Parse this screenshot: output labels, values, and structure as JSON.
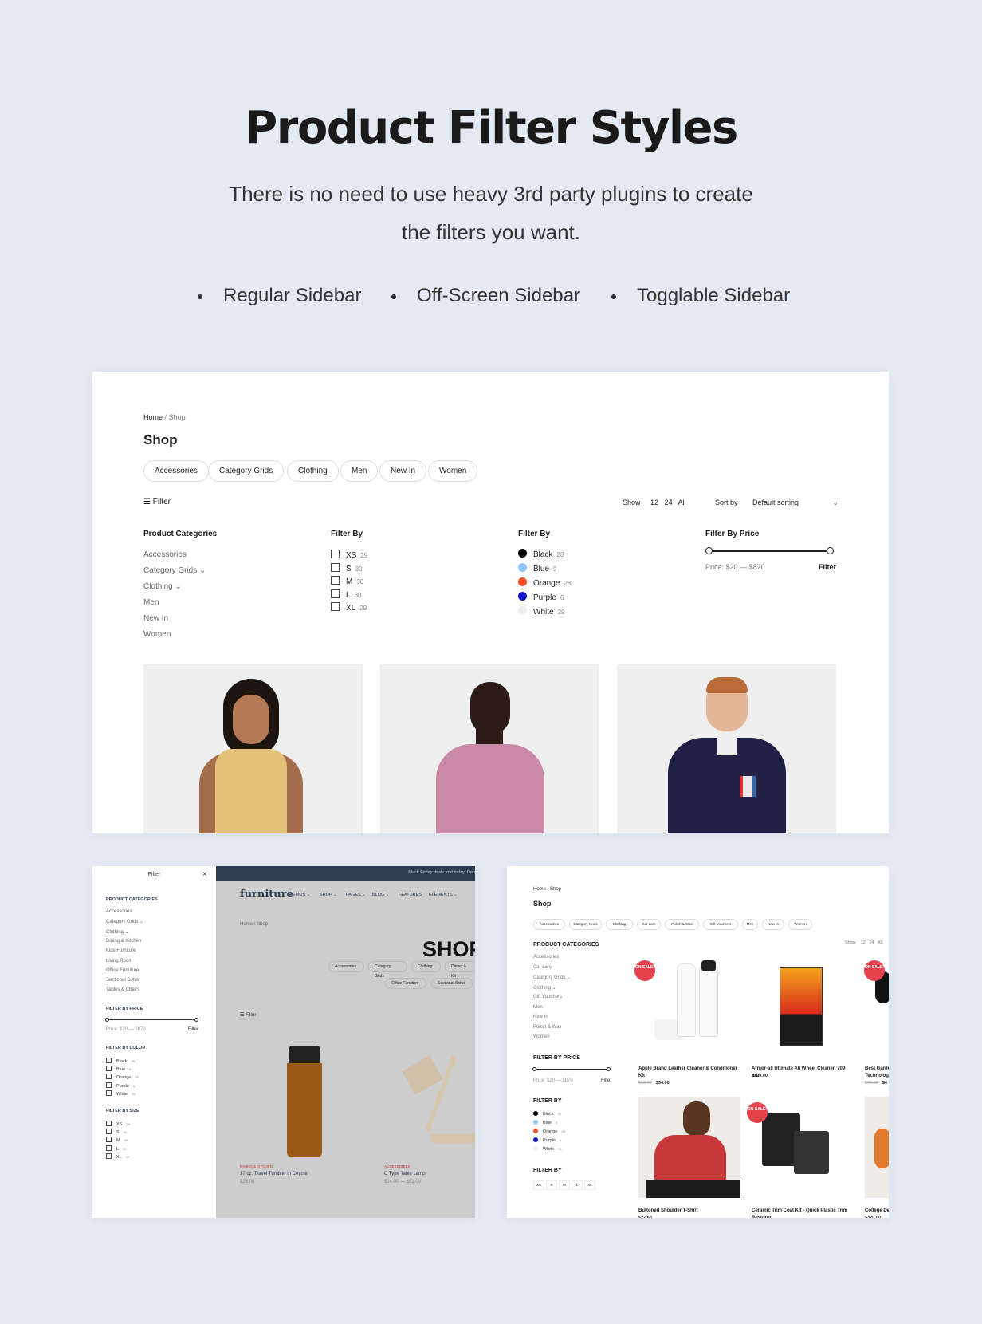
{
  "hero": {
    "title": "Product Filter Styles",
    "subtitle_line1": "There is no need to use heavy 3rd party plugins to create",
    "subtitle_line2": "the filters you want.",
    "bullets": [
      "Regular Sidebar",
      "Off-Screen Sidebar",
      "Togglable Sidebar"
    ]
  },
  "regular": {
    "breadcrumb": {
      "home": "Home",
      "sep": "/",
      "current": "Shop"
    },
    "title": "Shop",
    "pills": [
      "Accessories",
      "Category Grids",
      "Clothing",
      "Men",
      "New In",
      "Women"
    ],
    "filter_label": "Filter",
    "show_label": "Show",
    "show_options": [
      "12",
      "24",
      "All"
    ],
    "sort_label": "Sort by",
    "sort_value": "Default sorting",
    "categories": {
      "heading": "Product Categories",
      "items": [
        "Accessories",
        "Category Grids ⌄",
        "Clothing ⌄",
        "Men",
        "New In",
        "Women"
      ]
    },
    "sizes": {
      "heading": "Filter By",
      "items": [
        {
          "label": "XS",
          "count": "29"
        },
        {
          "label": "S",
          "count": "30"
        },
        {
          "label": "M",
          "count": "30"
        },
        {
          "label": "L",
          "count": "30"
        },
        {
          "label": "XL",
          "count": "29"
        }
      ]
    },
    "colors": {
      "heading": "Filter By",
      "items": [
        {
          "label": "Black",
          "count": "28",
          "color": "#000000"
        },
        {
          "label": "Blue",
          "count": "9",
          "color": "#8ec5fc"
        },
        {
          "label": "Orange",
          "count": "28",
          "color": "#f4502b"
        },
        {
          "label": "Purple",
          "count": "6",
          "color": "#1414c8"
        },
        {
          "label": "White",
          "count": "29",
          "color": "#eeeeee"
        }
      ]
    },
    "price": {
      "heading": "Filter By Price",
      "text": "Price: $20 — $870",
      "button": "Filter",
      "min": 20,
      "max": 870
    }
  },
  "offscreen": {
    "sidebar": {
      "title": "Filter",
      "close": "×",
      "categories": {
        "heading": "PRODUCT CATEGORIES",
        "items": [
          "Accessories",
          "Category Grids ⌄",
          "Clothing ⌄",
          "Dining & Kitchen",
          "Kids Furniture",
          "Living Room",
          "Office Furniture",
          "Sectional Sofas",
          "Tables & Chairs"
        ]
      },
      "price": {
        "heading": "FILTER BY PRICE",
        "text": "Price: $20 — $870",
        "button": "Filter"
      },
      "colors": {
        "heading": "FILTER BY COLOR",
        "items": [
          {
            "label": "Black",
            "count": "29"
          },
          {
            "label": "Blue",
            "count": "9"
          },
          {
            "label": "Orange",
            "count": "28"
          },
          {
            "label": "Purple",
            "count": "6"
          },
          {
            "label": "White",
            "count": "29"
          }
        ]
      },
      "sizes": {
        "heading": "FILTER BY SIZE",
        "items": [
          {
            "label": "XS",
            "count": "29"
          },
          {
            "label": "S",
            "count": "30"
          },
          {
            "label": "M",
            "count": "30"
          },
          {
            "label": "L",
            "count": "30"
          },
          {
            "label": "XL",
            "count": "29"
          }
        ]
      }
    },
    "page": {
      "topbar": "Black Friday deals end today! Don",
      "logo": "furniture",
      "nav": [
        "DEMOS ⌄",
        "SHOP ⌄",
        "PAGES ⌄",
        "BLOG ⌄",
        "FEATURES",
        "ELEMENTS ⌄"
      ],
      "breadcrumb": "Home / Shop",
      "title": "SHOP",
      "pills_row1": [
        "Accessories",
        "Category Grids",
        "Clothing",
        "Dining & Kit"
      ],
      "pills_row2": [
        "Office Furniture",
        "Sectional Sofas"
      ],
      "filter_label": "Filter",
      "products": [
        {
          "category": "DINING & KITCHEN",
          "name": "17 oz. Travel Tumbler in Coyote",
          "price": "$28.00"
        },
        {
          "category": "ACCESSORIES",
          "name": "C Type Table Lamp",
          "price": "$24.00 — $62.00"
        }
      ]
    }
  },
  "togglable": {
    "breadcrumb": "Home / Shop",
    "title": "Shop",
    "pills": [
      "Accessories",
      "Category Grids",
      "Clothing",
      "Car care",
      "Polish & Wax",
      "Gift Vouchers",
      "Men",
      "New In",
      "Women"
    ],
    "show_label": "Show",
    "show_options": [
      "12",
      "24",
      "All"
    ],
    "categories": {
      "heading": "PRODUCT CATEGORIES",
      "items": [
        "Accessories",
        "Car care",
        "Category Grids ⌄",
        "Clothing ⌄",
        "Gift Vouchers",
        "Men",
        "New In",
        "Polish & Wax",
        "Women"
      ]
    },
    "price": {
      "heading": "FILTER BY PRICE",
      "text": "Price: $20 — $870",
      "button": "Filter"
    },
    "colors": {
      "heading": "FILTER BY",
      "items": [
        {
          "label": "Black",
          "count": "33",
          "color": "#000000"
        },
        {
          "label": "Blue",
          "count": "9",
          "color": "#8ec5fc"
        },
        {
          "label": "Orange",
          "count": "28",
          "color": "#f4502b"
        },
        {
          "label": "Purple",
          "count": "6",
          "color": "#1414c8"
        },
        {
          "label": "White",
          "count": "28",
          "color": "#eeeeee"
        }
      ]
    },
    "sizes": {
      "heading": "FILTER BY",
      "items": [
        "XS",
        "S",
        "M",
        "L",
        "XL"
      ]
    },
    "badge": "ON SALE!",
    "products": [
      {
        "name": "Apple Brand Leather Cleaner & Conditioner Kit",
        "old_price": "$68.00",
        "price": "$34.00"
      },
      {
        "name": "Armor-all Ultimate All Wheel Cleaner, 709-mL",
        "price": "$299.00"
      },
      {
        "name": "Best Garden Technology",
        "old_price": "$96.00",
        "price": "$4"
      },
      {
        "name": "Buttoned Shoulder T-Shirt",
        "price": "$22.60"
      },
      {
        "name": "Ceramic Trim Coat Kit - Quick Plastic Trim Restorer",
        "price": ""
      },
      {
        "name": "College Dei",
        "price": "$320.00"
      }
    ]
  }
}
